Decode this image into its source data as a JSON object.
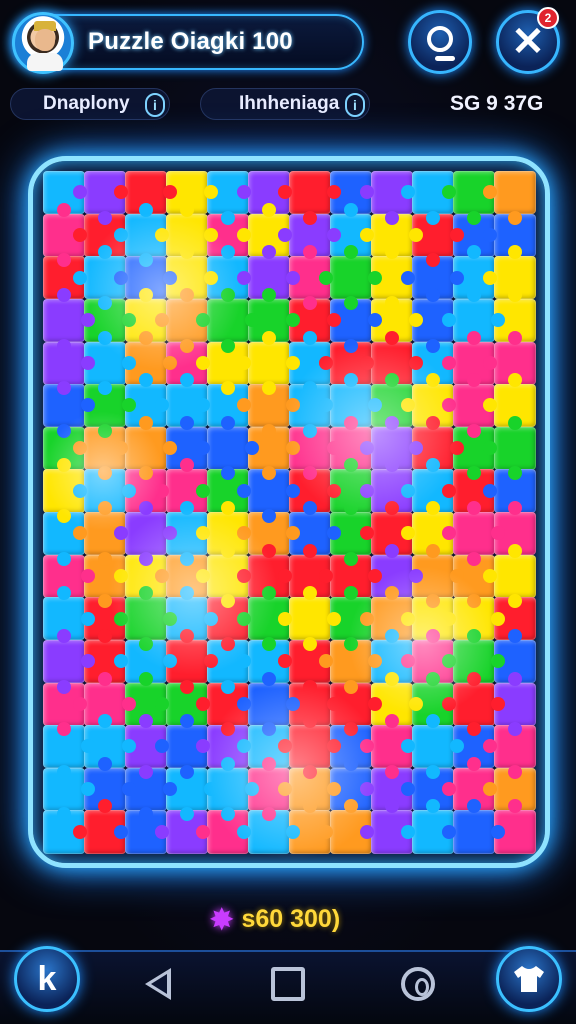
{
  "header": {
    "title": "Puzzle Oiagki 100",
    "notification_count": "2"
  },
  "stats": {
    "left_label": "Dnaplony",
    "mid_label": "Ihnheniaga",
    "score": "SG 9 37G",
    "info_glyph": "i"
  },
  "board": {
    "rows": 16,
    "cols": 12,
    "piece_colors": [
      "#ff1e2d",
      "#ffe600",
      "#18d32a",
      "#12b8ff",
      "#8a3cff",
      "#ff2f8c",
      "#ff9a1f",
      "#1e62ff"
    ]
  },
  "footer": {
    "counter_text": "s60 300)",
    "star_icon": "star-icon"
  },
  "navbar": {
    "left_icon": "pointer-icon",
    "right_icon": "shirt-icon"
  }
}
